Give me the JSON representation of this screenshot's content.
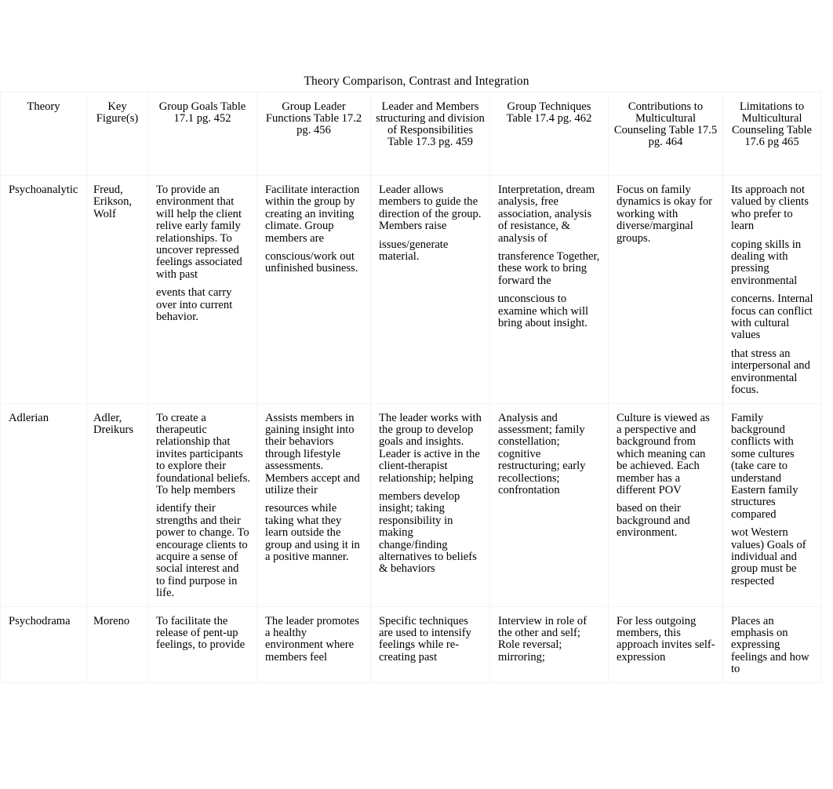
{
  "document": {
    "title": "Theory Comparison, Contrast and Integration"
  },
  "table": {
    "headers": [
      "Theory",
      "Key Figure(s)",
      "Group Goals Table 17.1 pg. 452",
      "Group Leader Functions Table 17.2 pg. 456",
      "Leader and Members structuring and division of Responsibilities Table 17.3 pg. 459",
      "Group Techniques Table 17.4 pg. 462",
      "Contributions to Multicultural Counseling Table 17.5 pg. 464",
      "Limitations to Multicultural Counseling Table 17.6 pg 465"
    ],
    "rows": [
      {
        "theory": "Psychoanalytic",
        "figures": [
          "Freud,",
          "Erikson,",
          "Wolf"
        ],
        "goals": [
          "To provide an environment that will help the client relive early family relationships. To uncover repressed feelings associated with past",
          "events that carry over into current behavior."
        ],
        "leader_functions": [
          "Facilitate interaction within the group by creating an inviting climate. Group members are",
          "conscious/work out unfinished business."
        ],
        "structuring": [
          "Leader allows members to guide the direction of the group. Members raise",
          "issues/generate material."
        ],
        "techniques": [
          "Interpretation, dream analysis, free association, analysis of resistance, & analysis of",
          "transference Together, these work to bring forward the",
          "unconscious to examine which will bring about insight."
        ],
        "contributions": [
          "Focus on family dynamics is okay for working with diverse/marginal groups."
        ],
        "limitations": [
          "Its approach not valued by clients who prefer to learn",
          "coping skills in dealing with pressing environmental",
          "concerns. Internal focus can conflict with cultural values",
          "that stress an interpersonal and environmental focus."
        ]
      },
      {
        "theory": "Adlerian",
        "figures": [
          "Adler,",
          "Dreikurs"
        ],
        "goals": [
          "To create a therapeutic relationship that invites participants to explore their foundational beliefs. To help members",
          "identify their strengths and their power to change. To encourage clients to acquire a sense of social interest and to find purpose in life."
        ],
        "leader_functions": [
          "Assists members in gaining insight into their behaviors through lifestyle assessments. Members accept and utilize their",
          "resources while taking what they learn outside the group and using it in a positive manner."
        ],
        "structuring": [
          "The leader works with the group to develop goals and insights. Leader is active in the client-therapist relationship; helping",
          "members develop insight; taking responsibility in making change/finding alternatives to beliefs & behaviors"
        ],
        "techniques": [
          "Analysis and assessment; family constellation; cognitive restructuring; early recollections; confrontation"
        ],
        "contributions": [
          "Culture is viewed as a perspective and background from which meaning can be achieved. Each member has a different POV",
          "based on their background and environment."
        ],
        "limitations": [
          "Family background conflicts with some cultures (take care to understand Eastern family structures compared",
          "wot Western values) Goals of individual and group must be respected"
        ]
      },
      {
        "theory": "Psychodrama",
        "figures": [
          "Moreno"
        ],
        "goals": [
          "To facilitate the release of pent-up feelings, to provide"
        ],
        "leader_functions": [
          "The leader promotes a healthy environment where members feel"
        ],
        "structuring": [
          "Specific techniques are used to intensify feelings while re-creating past"
        ],
        "techniques": [
          "Interview in role of the other and self; Role reversal; mirroring;"
        ],
        "contributions": [
          "For less outgoing members, this approach invites self-expression"
        ],
        "limitations": [
          "Places an emphasis on expressing feelings and how to"
        ]
      }
    ]
  }
}
